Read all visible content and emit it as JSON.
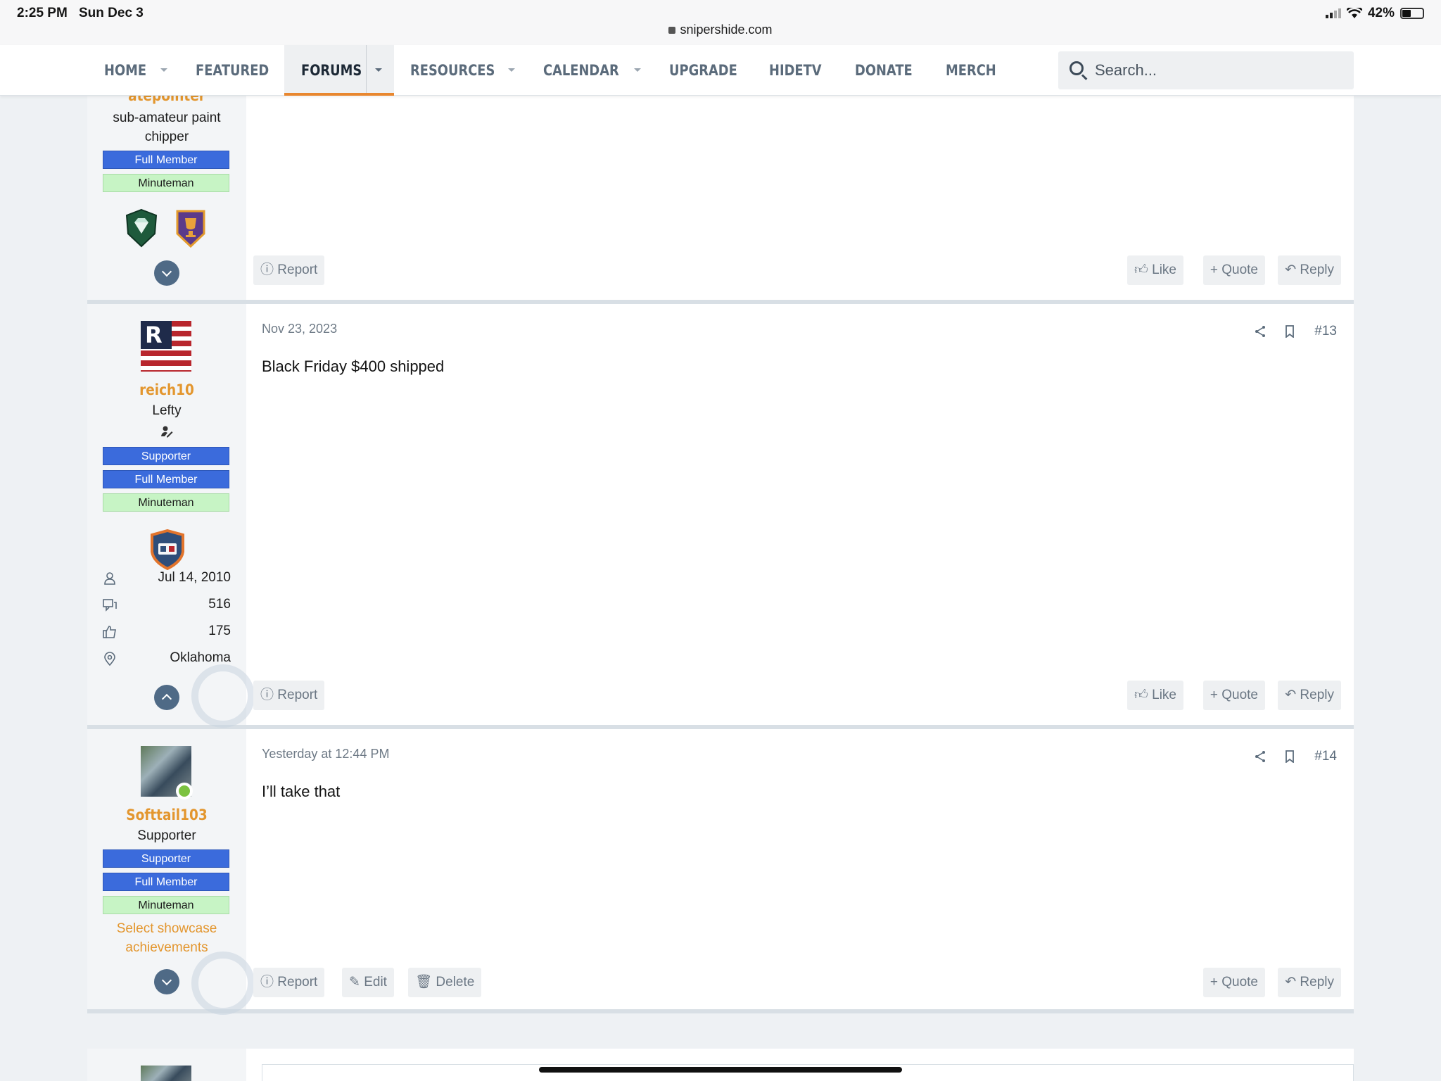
{
  "status": {
    "time": "2:25 PM",
    "date": "Sun Dec 3",
    "url": "snipershide.com",
    "battery": "42%"
  },
  "nav": {
    "items": [
      {
        "label": "HOME"
      },
      {
        "label": "FEATURED"
      },
      {
        "label": "FORUMS"
      },
      {
        "label": "RESOURCES"
      },
      {
        "label": "CALENDAR"
      },
      {
        "label": "UPGRADE"
      },
      {
        "label": "HIDETV"
      },
      {
        "label": "DONATE"
      },
      {
        "label": "MERCH"
      }
    ],
    "active": "FORUMS",
    "search_placeholder": "Search..."
  },
  "post_prev": {
    "username": "atepointer",
    "title_line1": "sub-amateur paint",
    "title_line2": "chipper",
    "banners": [
      "Full Member",
      "Minuteman"
    ],
    "actions": {
      "report": "Report",
      "like": "Like",
      "quote": "Quote",
      "reply": "Reply"
    }
  },
  "post13": {
    "username": "reich10",
    "user_title": "Lefty",
    "banners": [
      "Supporter",
      "Full Member",
      "Minuteman"
    ],
    "stats": {
      "joined": "Jul 14, 2010",
      "messages": "516",
      "reactions": "175",
      "location": "Oklahoma"
    },
    "date": "Nov 23, 2023",
    "number": "#13",
    "body": "Black Friday $400 shipped",
    "actions": {
      "report": "Report",
      "like": "Like",
      "quote": "Quote",
      "reply": "Reply"
    }
  },
  "post14": {
    "username": "Softtail103",
    "user_title": "Supporter",
    "banners": [
      "Supporter",
      "Full Member",
      "Minuteman"
    ],
    "showcase_line1": "Select showcase",
    "showcase_line2": "achievements",
    "date": "Yesterday at 12:44 PM",
    "number": "#14",
    "body": "I’ll take that",
    "actions": {
      "report": "Report",
      "edit": "Edit",
      "delete": "Delete",
      "quote": "Quote",
      "reply": "Reply"
    }
  },
  "colors": {
    "accent": "#e8872f",
    "username": "#e3962e",
    "banner_blue": "#3b6bdc",
    "banner_green": "#c7f4c5",
    "nav_text": "#5b6b7b"
  }
}
